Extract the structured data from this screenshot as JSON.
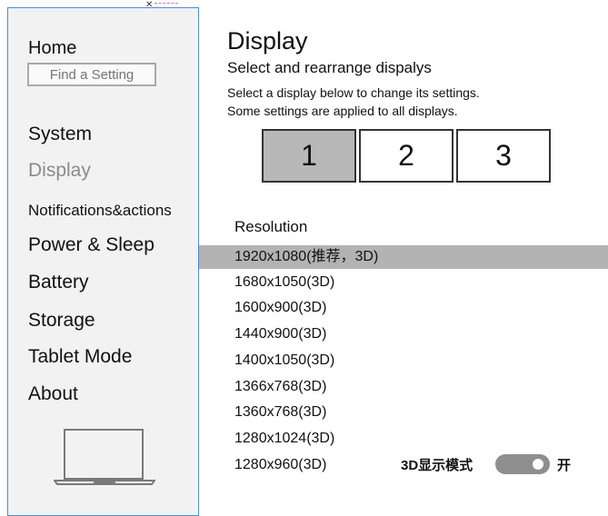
{
  "sidebar": {
    "home_label": "Home",
    "search_placeholder": "Find a Setting",
    "items": [
      {
        "label": "System"
      },
      {
        "label": "Display",
        "active": true
      },
      {
        "label": "Notifications&actions"
      },
      {
        "label": "Power & Sleep"
      },
      {
        "label": "Battery"
      },
      {
        "label": "Storage"
      },
      {
        "label": "Tablet Mode"
      },
      {
        "label": "About"
      }
    ],
    "device_icon": "laptop-icon"
  },
  "main": {
    "title": "Display",
    "subtitle": "Select and rearrange dispalys",
    "hint_line1": "Select a display below to change its settings.",
    "hint_line2": "Some settings are applied to all displays.",
    "monitors": [
      {
        "label": "1",
        "selected": true
      },
      {
        "label": "2"
      },
      {
        "label": "3"
      }
    ],
    "resolution_label": "Resolution",
    "resolutions": [
      "1920x1080(推荐，3D)",
      "1680x1050(3D)",
      "1600x900(3D)",
      "1440x900(3D)",
      "1400x1050(3D)",
      "1366x768(3D)",
      "1360x768(3D)",
      "1280x1024(3D)",
      "1280x960(3D)"
    ],
    "selected_resolution_index": 0,
    "mode_label": "3D显示模式",
    "mode_state": "开",
    "mode_on": true
  },
  "colors": {
    "selected_bg": "#b3b3b3",
    "inactive_text": "#8b8b8b",
    "sidebar_bg": "#f2f2f2",
    "toggle_on": "#8e8e8e",
    "window_border": "#4a8ad8"
  }
}
